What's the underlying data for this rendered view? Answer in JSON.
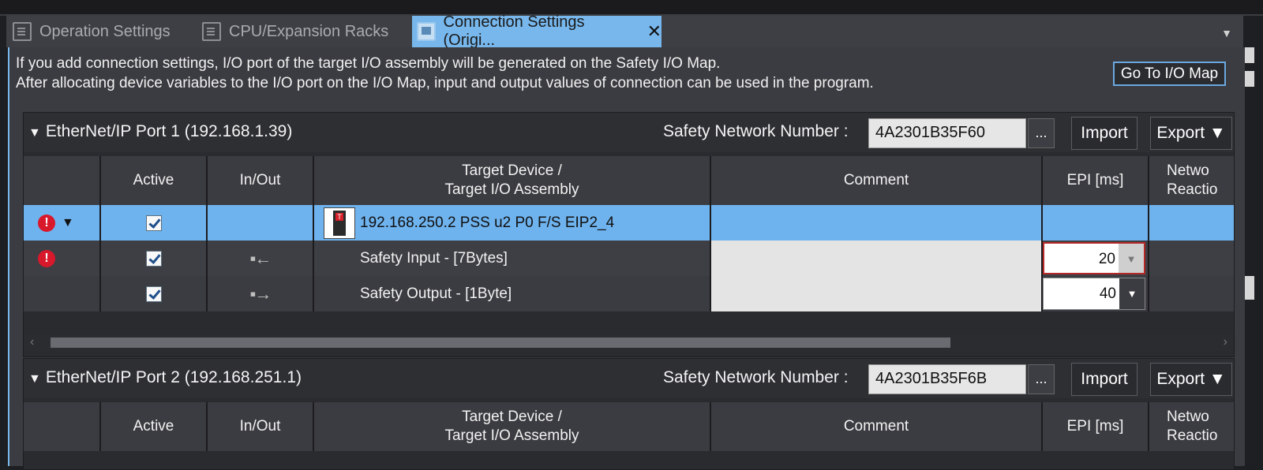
{
  "tabs": [
    {
      "label": "Operation Settings"
    },
    {
      "label": "CPU/Expansion Racks"
    },
    {
      "label": "Connection Settings (Origi...",
      "active": true
    }
  ],
  "info": {
    "line1": "If you add connection settings, I/O port of the target I/O assembly will be generated on the Safety I/O Map.",
    "line2": "After allocating device variables to the I/O port on the I/O Map, input and output values of connection can be used in the program.",
    "goto_button": "Go To I/O Map"
  },
  "columns": {
    "active": "Active",
    "inout": "In/Out",
    "target_line1": "Target Device /",
    "target_line2": "Target I/O Assembly",
    "comment": "Comment",
    "epi": "EPI [ms]",
    "network_line1": "Netwo",
    "network_line2": "Reactio"
  },
  "ports": [
    {
      "title": "EtherNet/IP Port 1 (192.168.1.39)",
      "snn_label": "Safety Network Number :",
      "snn_value": "4A2301B35F60",
      "more": "...",
      "import": "Import",
      "export": "Export ▼",
      "rows": [
        {
          "device": "192.168.250.2 PSS u2 P0 F/S EIP2_4",
          "error": true,
          "selected": true
        },
        {
          "name": "Safety Input - [7Bytes]",
          "epi": "20",
          "error": true
        },
        {
          "name": "Safety Output - [1Byte]",
          "epi": "40",
          "error": false
        }
      ]
    },
    {
      "title": "EtherNet/IP Port 2 (192.168.251.1)",
      "snn_label": "Safety Network Number :",
      "snn_value": "4A2301B35F6B",
      "more": "...",
      "import": "Import",
      "export": "Export ▼"
    }
  ],
  "colors": {
    "accent": "#77b7ec",
    "error": "#d8182b",
    "background": "#3b3c41"
  }
}
